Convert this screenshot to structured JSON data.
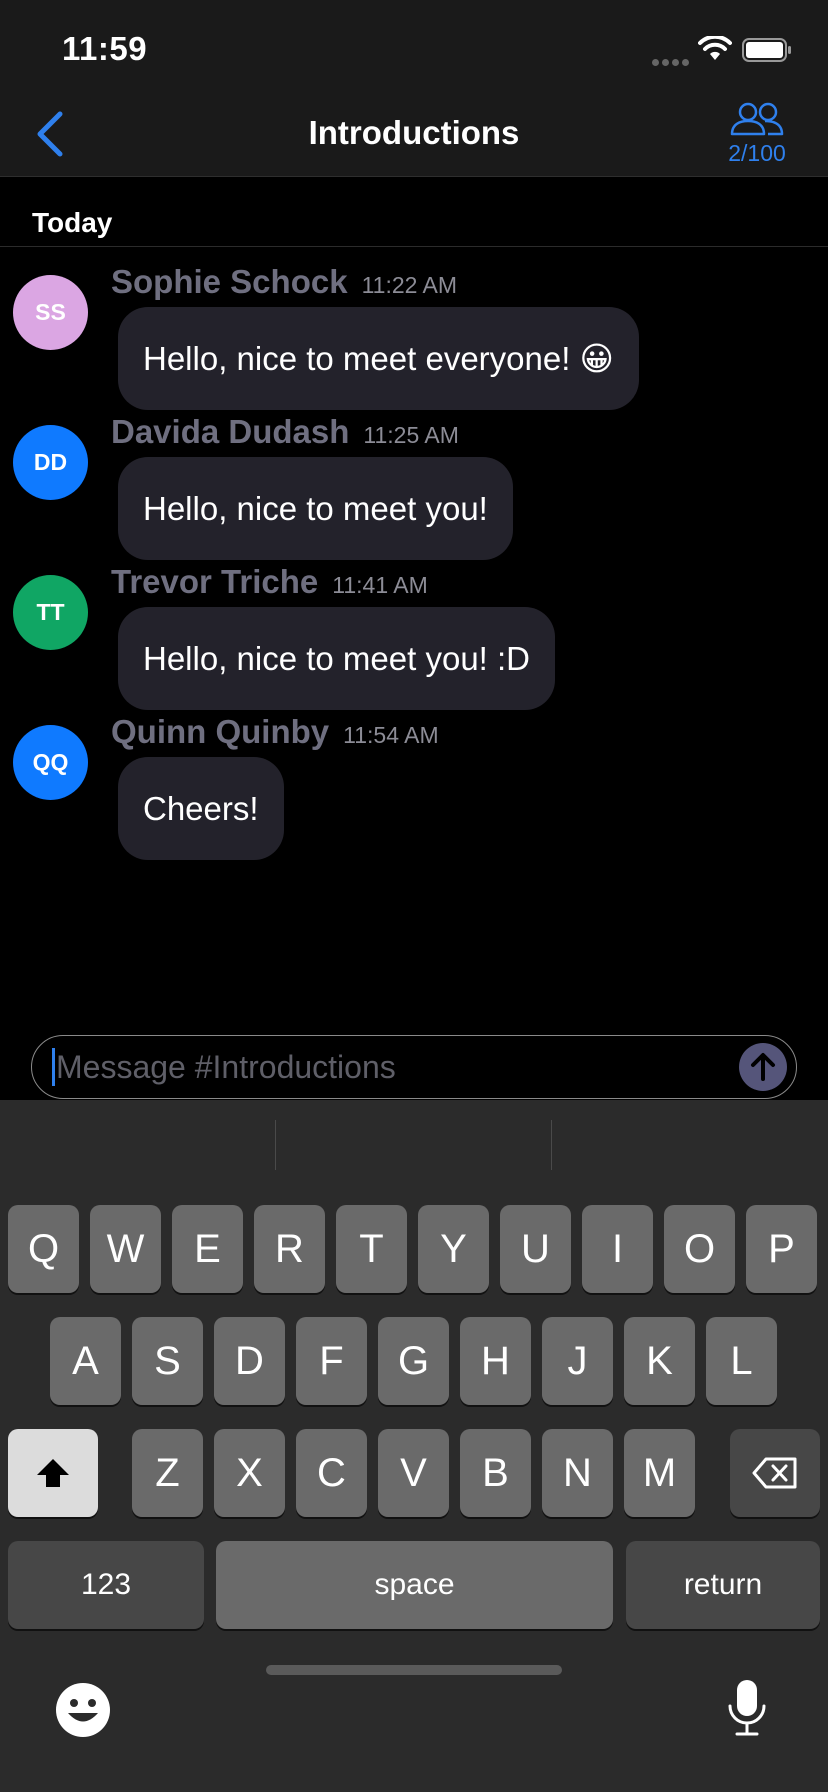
{
  "status_bar": {
    "time": "11:59"
  },
  "nav": {
    "title": "Introductions",
    "members_count": "2/100"
  },
  "section": {
    "label": "Today"
  },
  "messages": [
    {
      "initials": "SS",
      "avatar_color": "#dba6e3",
      "name": "Sophie Schock",
      "time": "11:22 AM",
      "text": "Hello, nice to meet everyone! 😀"
    },
    {
      "initials": "DD",
      "avatar_color": "#0f7aff",
      "name": "Davida Dudash",
      "time": "11:25 AM",
      "text": "Hello, nice to meet you!"
    },
    {
      "initials": "TT",
      "avatar_color": "#10a664",
      "name": "Trevor Triche",
      "time": "11:41 AM",
      "text": "Hello, nice to meet you! :D"
    },
    {
      "initials": "QQ",
      "avatar_color": "#0f7aff",
      "name": "Quinn Quinby",
      "time": "11:54 AM",
      "text": "Cheers!"
    }
  ],
  "composer": {
    "placeholder": "Message #Introductions"
  },
  "keyboard": {
    "row1": [
      "Q",
      "W",
      "E",
      "R",
      "T",
      "Y",
      "U",
      "I",
      "O",
      "P"
    ],
    "row2": [
      "A",
      "S",
      "D",
      "F",
      "G",
      "H",
      "J",
      "K",
      "L"
    ],
    "row3": [
      "Z",
      "X",
      "C",
      "V",
      "B",
      "N",
      "M"
    ],
    "numbers_label": "123",
    "space_label": "space",
    "return_label": "return"
  },
  "colors": {
    "accent": "#2f80ed",
    "bubble": "#23222b",
    "send_button": "#55557a",
    "sender_name": "#6f6f80"
  }
}
